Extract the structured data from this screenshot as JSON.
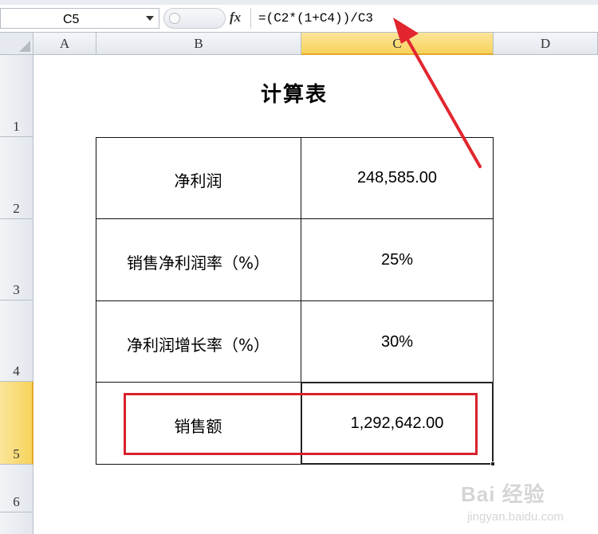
{
  "formula_bar": {
    "name_box": "C5",
    "fx_label": "fx",
    "formula": "=(C2*(1+C4))/C3"
  },
  "columns": [
    "A",
    "B",
    "C",
    "D"
  ],
  "active_column": "C",
  "rows": [
    "1",
    "2",
    "3",
    "4",
    "5",
    "6"
  ],
  "active_row": "5",
  "sheet": {
    "title": "计算表",
    "table": [
      {
        "label": "净利润",
        "value": "248,585.00"
      },
      {
        "label": "销售净利润率（%）",
        "value": "25%"
      },
      {
        "label": "净利润增长率（%）",
        "value": "30%"
      },
      {
        "label": "销售额",
        "value": "1,292,642.00"
      }
    ]
  },
  "annotations": {
    "highlight_color": "#d8222d",
    "arrow_color": "#e2262f"
  },
  "watermark": {
    "brand": "Bai 经验",
    "url": "jingyan.baidu.com"
  }
}
